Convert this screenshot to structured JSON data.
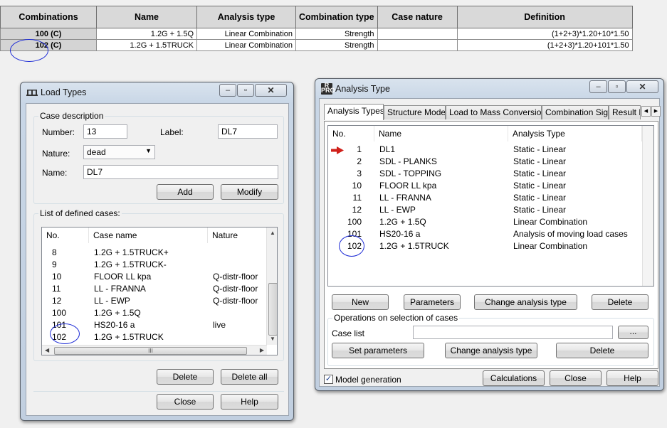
{
  "combinations_table": {
    "headers": [
      "Combinations",
      "Name",
      "Analysis type",
      "Combination type",
      "Case nature",
      "Definition"
    ],
    "rows": [
      [
        "100 (C)",
        "1.2G + 1.5Q",
        "Linear Combination",
        "Strength",
        "",
        "(1+2+3)*1.20+10*1.50"
      ],
      [
        "102 (C)",
        "1.2G + 1.5TRUCK",
        "Linear Combination",
        "Strength",
        "",
        "(1+2+3)*1.20+101*1.50"
      ]
    ]
  },
  "load_types": {
    "title": "Load Types",
    "case_description_label": "Case description",
    "number_label": "Number:",
    "number_value": "13",
    "label_label": "Label:",
    "label_value": "DL7",
    "nature_label": "Nature:",
    "nature_value": "dead",
    "name_label": "Name:",
    "name_value": "DL7",
    "add_label": "Add",
    "modify_label": "Modify",
    "list_label": "List of defined cases:",
    "columns": [
      "No.",
      "Case name",
      "Nature"
    ],
    "rows": [
      {
        "no": "8",
        "name": "1.2G + 1.5TRUCK+",
        "nature": ""
      },
      {
        "no": "9",
        "name": "1.2G + 1.5TRUCK-",
        "nature": ""
      },
      {
        "no": "10",
        "name": "FLOOR LL kpa",
        "nature": "Q-distr-floor"
      },
      {
        "no": "11",
        "name": "LL - FRANNA",
        "nature": "Q-distr-floor"
      },
      {
        "no": "12",
        "name": "LL - EWP",
        "nature": "Q-distr-floor"
      },
      {
        "no": "100",
        "name": "1.2G + 1.5Q",
        "nature": ""
      },
      {
        "no": "101",
        "name": "HS20-16 a",
        "nature": "live"
      },
      {
        "no": "102",
        "name": "1.2G + 1.5TRUCK",
        "nature": ""
      }
    ],
    "scroll_glyph": "III",
    "delete_label": "Delete",
    "delete_all_label": "Delete all",
    "close_label": "Close",
    "help_label": "Help"
  },
  "analysis_type": {
    "title": "Analysis Type",
    "app_icon_text": "R PRO",
    "tabs": [
      "Analysis Types",
      "Structure Model",
      "Load to Mass Conversion",
      "Combination Sign",
      "Result F"
    ],
    "columns": [
      "No.",
      "Name",
      "Analysis Type"
    ],
    "rows": [
      {
        "no": "1",
        "name": "DL1",
        "type": "Static - Linear"
      },
      {
        "no": "2",
        "name": "SDL - PLANKS",
        "type": "Static - Linear"
      },
      {
        "no": "3",
        "name": "SDL - TOPPING",
        "type": "Static - Linear"
      },
      {
        "no": "10",
        "name": "FLOOR LL kpa",
        "type": "Static - Linear"
      },
      {
        "no": "11",
        "name": "LL - FRANNA",
        "type": "Static - Linear"
      },
      {
        "no": "12",
        "name": "LL - EWP",
        "type": "Static - Linear"
      },
      {
        "no": "100",
        "name": "1.2G + 1.5Q",
        "type": "Linear Combination"
      },
      {
        "no": "101",
        "name": "HS20-16 a",
        "type": "Analysis of moving load cases"
      },
      {
        "no": "102",
        "name": "1.2G + 1.5TRUCK",
        "type": "Linear Combination"
      }
    ],
    "new_label": "New",
    "parameters_label": "Parameters",
    "change_type_label": "Change analysis type",
    "delete_label": "Delete",
    "operations_label": "Operations on selection of cases",
    "case_list_label": "Case list",
    "case_list_value": "",
    "browse_label": "...",
    "set_parameters_label": "Set parameters",
    "change_type2_label": "Change analysis type",
    "delete2_label": "Delete",
    "model_generation_label": "Model generation",
    "model_generation_checked": true,
    "calculations_label": "Calculations",
    "close_label": "Close",
    "help_label": "Help"
  },
  "colors": {
    "annotation_circle": "#1d2bd6",
    "current_case_arrow": "#d0201a"
  }
}
